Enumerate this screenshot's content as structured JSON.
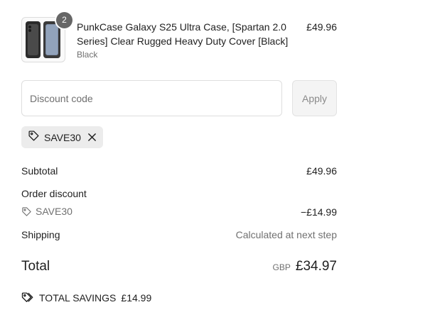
{
  "product": {
    "title": "PunkCase Galaxy S25 Ultra Case, [Spartan 2.0 Series] Clear Rugged Heavy Duty Cover [Black]",
    "variant": "Black",
    "price": "£49.96",
    "quantity": "2"
  },
  "discount": {
    "placeholder": "Discount code",
    "apply_label": "Apply",
    "applied_code": "SAVE30"
  },
  "summary": {
    "subtotal_label": "Subtotal",
    "subtotal_value": "£49.96",
    "order_discount_label": "Order discount",
    "discount_code": "SAVE30",
    "discount_value": "−£14.99",
    "shipping_label": "Shipping",
    "shipping_value": "Calculated at next step",
    "total_label": "Total",
    "currency": "GBP",
    "total_value": "£34.97"
  },
  "savings": {
    "label": "TOTAL SAVINGS",
    "value": "£14.99"
  },
  "colors": {
    "text": "#1f1f1f",
    "muted": "#707070",
    "chip_bg": "#ececec",
    "badge_bg": "#666666"
  },
  "icons": {
    "tag": "tag-icon",
    "close": "close-icon",
    "savings": "double-tag-icon"
  }
}
